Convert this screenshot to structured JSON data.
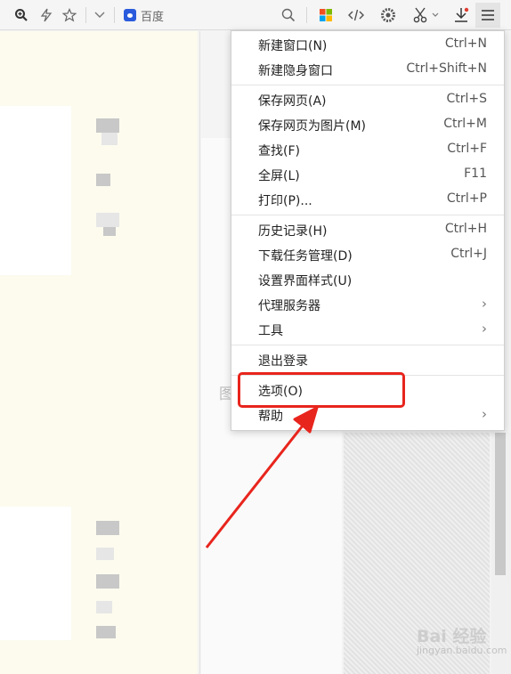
{
  "toolbar": {
    "icons": [
      "zoom-icon",
      "lightning-icon",
      "star-icon",
      "chevron-down-icon",
      "search-icon",
      "apps-grid-icon",
      "code-icon",
      "settings-gear-icon",
      "scissors-icon",
      "download-icon",
      "hamburger-menu-icon"
    ],
    "search_engine_label": "百度"
  },
  "menu": {
    "groups": [
      [
        {
          "label": "新建窗口(N)",
          "shortcut": "Ctrl+N"
        },
        {
          "label": "新建隐身窗口",
          "shortcut": "Ctrl+Shift+N"
        }
      ],
      [
        {
          "label": "保存网页(A)",
          "shortcut": "Ctrl+S"
        },
        {
          "label": "保存网页为图片(M)",
          "shortcut": "Ctrl+M"
        },
        {
          "label": "查找(F)",
          "shortcut": "Ctrl+F"
        },
        {
          "label": "全屏(L)",
          "shortcut": "F11"
        },
        {
          "label": "打印(P)...",
          "shortcut": "Ctrl+P"
        }
      ],
      [
        {
          "label": "历史记录(H)",
          "shortcut": "Ctrl+H"
        },
        {
          "label": "下载任务管理(D)",
          "shortcut": "Ctrl+J"
        },
        {
          "label": "设置界面样式(U)",
          "shortcut": ""
        },
        {
          "label": "代理服务器",
          "shortcut": "",
          "submenu": true
        },
        {
          "label": "工具",
          "shortcut": "",
          "submenu": true
        }
      ],
      [
        {
          "label": "退出登录",
          "shortcut": ""
        }
      ],
      [
        {
          "label": "选项(O)",
          "shortcut": "",
          "highlighted": true
        },
        {
          "label": "帮助",
          "shortcut": "",
          "submenu": true
        }
      ]
    ],
    "submenu_glyph": "›"
  },
  "page": {
    "partial_text": "图"
  },
  "annotation": {
    "color": "#e8251d"
  },
  "watermark": {
    "logo": "Bai 经验",
    "url": "jingyan.baidu.com"
  }
}
